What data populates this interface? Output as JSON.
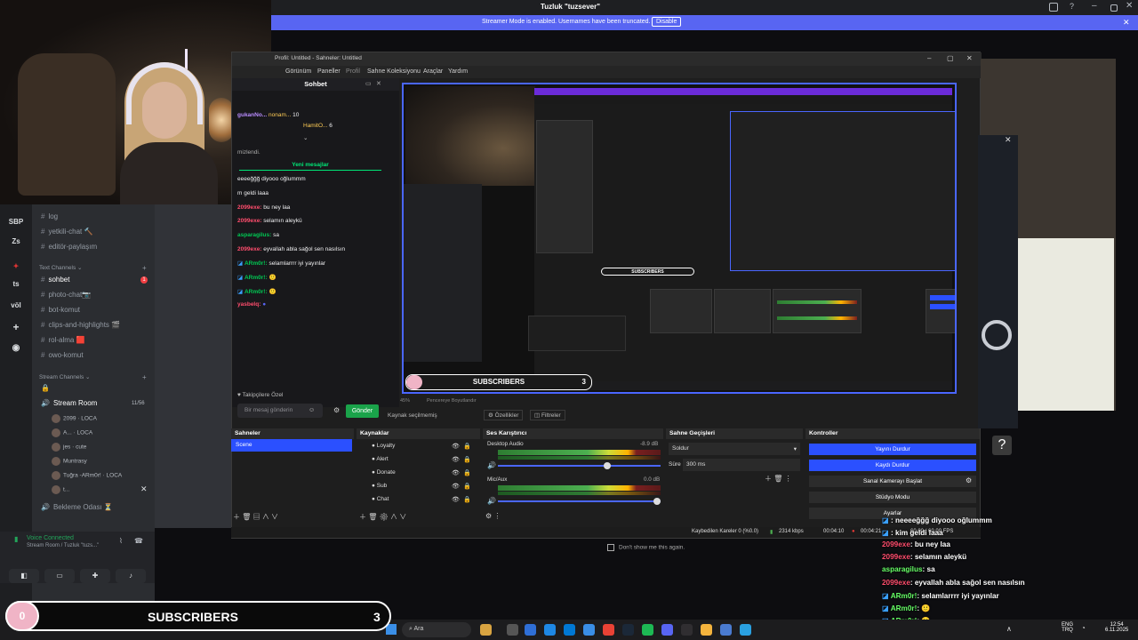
{
  "discord": {
    "window_title": "Tuzluk \"tuzsever\"",
    "streamer_mode": {
      "message": "Streamer Mode is enabled. Usernames have been truncated.",
      "button": "Disable"
    },
    "servers": [
      "SBP",
      "Zs",
      "ts",
      "völ"
    ],
    "channels_top": [
      {
        "name": "log"
      },
      {
        "name": "yetkili-chat",
        "emoji": "🔨"
      },
      {
        "name": "editör-paylaşım"
      }
    ],
    "text_channels_label": "Text Channels",
    "text_channels": [
      {
        "name": "sohbet",
        "active": true,
        "badge": "1"
      },
      {
        "name": "photo-chat",
        "emoji": "📷"
      },
      {
        "name": "bot-komut"
      },
      {
        "name": "clips-and-highlights",
        "emoji": "🎬"
      },
      {
        "name": "rol-alma",
        "emoji": "🟥"
      },
      {
        "name": "owo-komut"
      }
    ],
    "stream_channels_label": "Stream Channels",
    "stream_room": {
      "name": "Stream Room",
      "limit": "11/56"
    },
    "voice_users": [
      {
        "name": "2099",
        "tag": "LOCA"
      },
      {
        "name": "A...",
        "tag": "LOCA"
      },
      {
        "name": "jes",
        "tag": "cute"
      },
      {
        "name": "Muntrasy",
        "tag": ""
      },
      {
        "name": "Tuğra -ARm0r!",
        "tag": "LOCA"
      },
      {
        "name": "t...",
        "tag": ""
      }
    ],
    "waiting_room": "Bekleme Odası ⏳",
    "voice_connected": "Voice Connected",
    "voice_sub": "Stream Room / Tuzluk \"tuzs...\""
  },
  "obs": {
    "title": "Profil: Untitled - Sahneler: Untitled",
    "menu": [
      "Görünüm",
      "Paneller",
      "Profil",
      "Sahne Koleksiyonu",
      "Araçlar",
      "Yardım"
    ],
    "chat": {
      "header": "Sohbet",
      "top_users": [
        {
          "name": "gukanNo...",
          "sub": "nonam...",
          "count": "10"
        },
        {
          "name": "",
          "sub": "HamitO...",
          "count": "6"
        }
      ],
      "pinned": "mizlendi.",
      "new_messages": "Yeni mesajlar",
      "messages": [
        {
          "user": "",
          "text": "eeeeğğğ diyooo oğlummm",
          "color": "#ffffff"
        },
        {
          "user": "",
          "text": "m geldi laaa",
          "color": "#ffffff"
        },
        {
          "user": "2099exe:",
          "text": "bu ney laa",
          "color": "#ff4d6d"
        },
        {
          "user": "2099exe:",
          "text": "selamın aleykü",
          "color": "#ff4d6d"
        },
        {
          "user": "asparagilus:",
          "text": "sa",
          "color": "#00c853"
        },
        {
          "user": "2099exe:",
          "text": "eyvallah abla sağol sen nasılsın",
          "color": "#ff4d6d"
        },
        {
          "user": "ARm0r!:",
          "text": "selamlarrrr iyi yayınlar",
          "color": "#00c853"
        },
        {
          "user": "ARm0r!:",
          "text": "🙂",
          "color": "#00c853"
        },
        {
          "user": "ARm0r!:",
          "text": "🙂",
          "color": "#00c853"
        },
        {
          "user": "yasbelq:",
          "text": "",
          "color": "#ff4d6d"
        }
      ],
      "highlight": "Takipçilere Özel",
      "placeholder": "Bir mesaj gönderin",
      "send": "Gönder"
    },
    "below_preview": [
      "45%",
      "Pencereye Boyutlandır"
    ],
    "source_bar": {
      "label": "Kaynak seçilmemiş",
      "props": "Özellikler",
      "filters": "Filtreler"
    },
    "docks": {
      "scenes": {
        "title": "Sahneler",
        "items": [
          "Scene"
        ]
      },
      "sources": {
        "title": "Kaynaklar",
        "items": [
          "Loyalty",
          "Alert",
          "Donate",
          "Sub",
          "Chat"
        ]
      },
      "mixer": {
        "title": "Ses Karıştırıcı",
        "channels": [
          {
            "name": "Desktop Audio",
            "db": "-8.9 dB"
          },
          {
            "name": "Mic/Aux",
            "db": "0.0 dB"
          }
        ],
        "ticks": [
          "-60",
          "-55",
          "-50",
          "-45",
          "-40",
          "-35",
          "-30",
          "-25",
          "-20",
          "-15",
          "-10",
          "-5",
          "0"
        ]
      },
      "transitions": {
        "title": "Sahne Geçişleri",
        "type": "Soldur",
        "duration_label": "Süre",
        "duration": "300 ms"
      },
      "controls": {
        "title": "Kontroller",
        "buttons": [
          "Yayını Durdur",
          "Kaydı Durdur",
          "Sanal Kamerayı Başlat",
          "Stüdyo Modu",
          "Ayarlar"
        ]
      }
    },
    "status": {
      "dropped": "Kaybedilen Kareler 0 (%0.0)",
      "kbps": "2314 kbps",
      "time1": "00:04:10",
      "time2": "00:04:21",
      "fps": "60.00 / 60.00 FPS"
    },
    "dont_show": "Don't show me this again."
  },
  "overlay": {
    "subscribers_label": "SUBSCRIBERS",
    "subscribers_count": "3",
    "subscribers_progress": "0",
    "nested_label": "SUBSCRIBERS",
    "nested_count": "3",
    "right_chat": [
      {
        "user": "",
        "text": ": neeeeğğğ diyooo oğlummm",
        "color": "#ffffff"
      },
      {
        "user": "",
        "text": ": kim geldi laaa",
        "color": "#ffffff"
      },
      {
        "user": "2099exe",
        "text": ": bu ney laa",
        "color": "#ff4d6d"
      },
      {
        "user": "2099exe",
        "text": ": selamın aleykü",
        "color": "#ff4d6d"
      },
      {
        "user": "asparagilus",
        "text": ": sa",
        "color": "#66ff66"
      },
      {
        "user": "2099exe",
        "text": ": eyvallah abla sağol sen nasılsın",
        "color": "#ff4d6d"
      },
      {
        "user": "ARm0r!",
        "text": ": selamlarrrr iyi yayınlar",
        "color": "#66ff66"
      },
      {
        "user": "ARm0r!",
        "text": ": 🙂",
        "color": "#66ff66"
      },
      {
        "user": "ARm0r!",
        "text": ": 🙂",
        "color": "#66ff66"
      },
      {
        "user": "yasbelq",
        "text": ":",
        "color": "#ff4d6d"
      }
    ]
  },
  "taskbar": {
    "search": "Ara",
    "lang": "ENG",
    "lang2": "TRQ",
    "time": "12:54",
    "date": "6.11.2025"
  }
}
